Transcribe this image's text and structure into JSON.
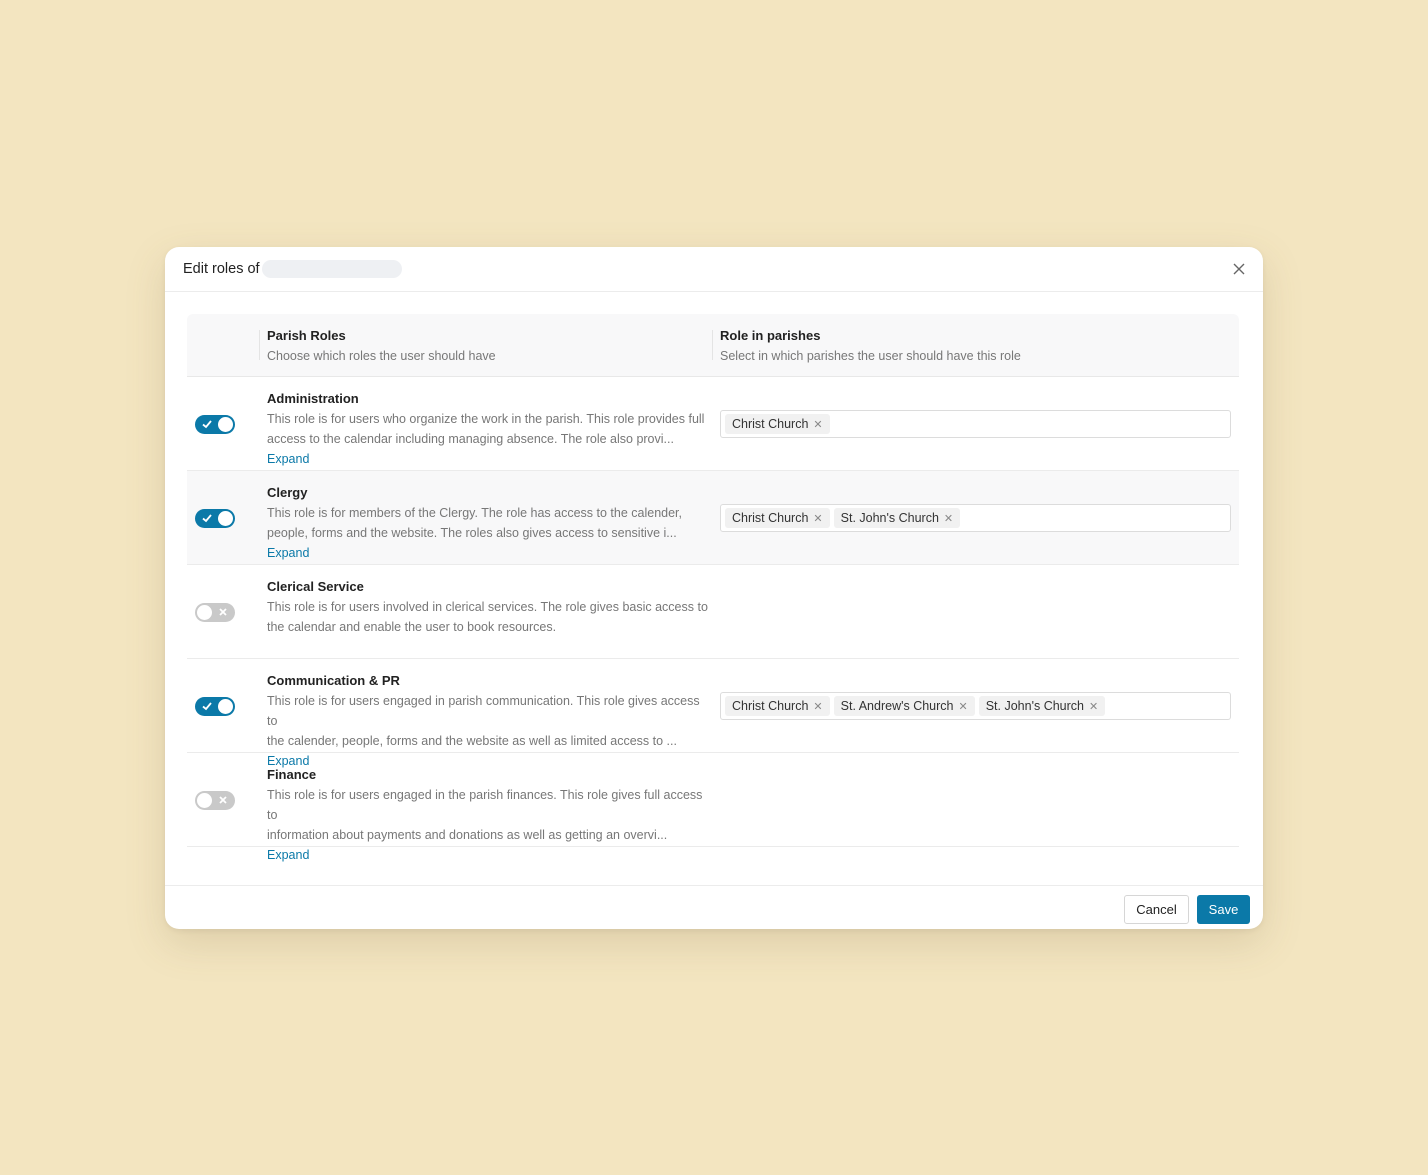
{
  "dialog": {
    "title": "Edit roles of",
    "cancel_label": "Cancel",
    "save_label": "Save"
  },
  "columns": {
    "roles_title": "Parish Roles",
    "roles_subtitle": "Choose which roles the user should have",
    "parishes_title": "Role in parishes",
    "parishes_subtitle": "Select in which parishes the user should have this role"
  },
  "expand_label": "Expand",
  "roles": [
    {
      "name": "Administration",
      "enabled": true,
      "line1": "This role is for users who organize the work in the parish. This role provides full",
      "line2": "access to the calendar including managing absence. The role also provi...",
      "parishes": [
        "Christ Church"
      ]
    },
    {
      "name": "Clergy",
      "enabled": true,
      "line1": "This role is for members of the Clergy. The role has access to the calender,",
      "line2": "people, forms and the website. The roles also gives access to sensitive i...",
      "parishes": [
        "Christ Church",
        "St. John's Church"
      ]
    },
    {
      "name": "Clerical Service",
      "enabled": false,
      "line1": "This role is for users involved in clerical services. The role gives basic access to",
      "line2": "the calendar and enable the user to book resources.",
      "parishes": []
    },
    {
      "name": "Communication & PR",
      "enabled": true,
      "line1": "This role is for users engaged in parish communication. This role gives access to",
      "line2": "the calender, people, forms and the website as well as limited access to ...",
      "parishes": [
        "Christ Church",
        "St. Andrew's Church",
        "St. John's Church"
      ]
    },
    {
      "name": "Finance",
      "enabled": false,
      "line1": "This role is for users engaged in the parish finances. This role gives full access to",
      "line2": "information about payments and donations as well as getting an overvi...",
      "parishes": []
    }
  ],
  "colors": {
    "accent": "#0b79a8",
    "background": "#f3e5c0",
    "toggle_off": "#c9c9c9"
  },
  "icons": {
    "close": "close-icon",
    "check": "check-icon",
    "cross": "x-icon",
    "tag_remove": "remove-tag-icon"
  }
}
